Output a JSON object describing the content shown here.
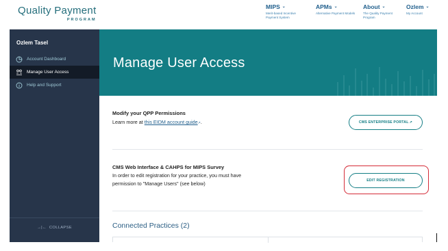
{
  "header": {
    "logo_main": "Quality Payment",
    "logo_sub": "PROGRAM",
    "nav": [
      {
        "title": "MIPS",
        "subtitle": "Merit-based Incentive Payment System"
      },
      {
        "title": "APMs",
        "subtitle": "Alternative Payment Models"
      },
      {
        "title": "About",
        "subtitle": "The Quality Payment Program"
      },
      {
        "title": "Ozlem",
        "subtitle": "My Account"
      }
    ]
  },
  "sidebar": {
    "user_name": "Ozlem Tasel",
    "items": [
      {
        "label": "Account Dashboard",
        "icon": "dashboard-icon"
      },
      {
        "label": "Manage User Access",
        "icon": "user-access-icon"
      },
      {
        "label": "Help and Support",
        "icon": "info-icon"
      }
    ],
    "active_item": "Manage User Access",
    "collapse_label": "COLLAPSE"
  },
  "hero": {
    "title": "Manage User Access"
  },
  "permissions": {
    "title": "Modify your QPP Permissions",
    "text_prefix": "Learn more at ",
    "link_text": "this EIDM account guide",
    "text_suffix": ".",
    "button_label": "CMS ENTERPRISE PORTAL"
  },
  "registration": {
    "title": "CMS Web Interface & CAHPS for MIPS Survey",
    "text_line1": "In order to edit registration for your practice, you must have",
    "text_line2": "permission to \"Manage Users\" (see below)",
    "button_label": "EDIT REGISTRATION"
  },
  "connected": {
    "title": "Connected Practices (2)"
  },
  "colors": {
    "teal": "#137d84",
    "navy": "#27354a",
    "highlight": "#d42a36"
  }
}
